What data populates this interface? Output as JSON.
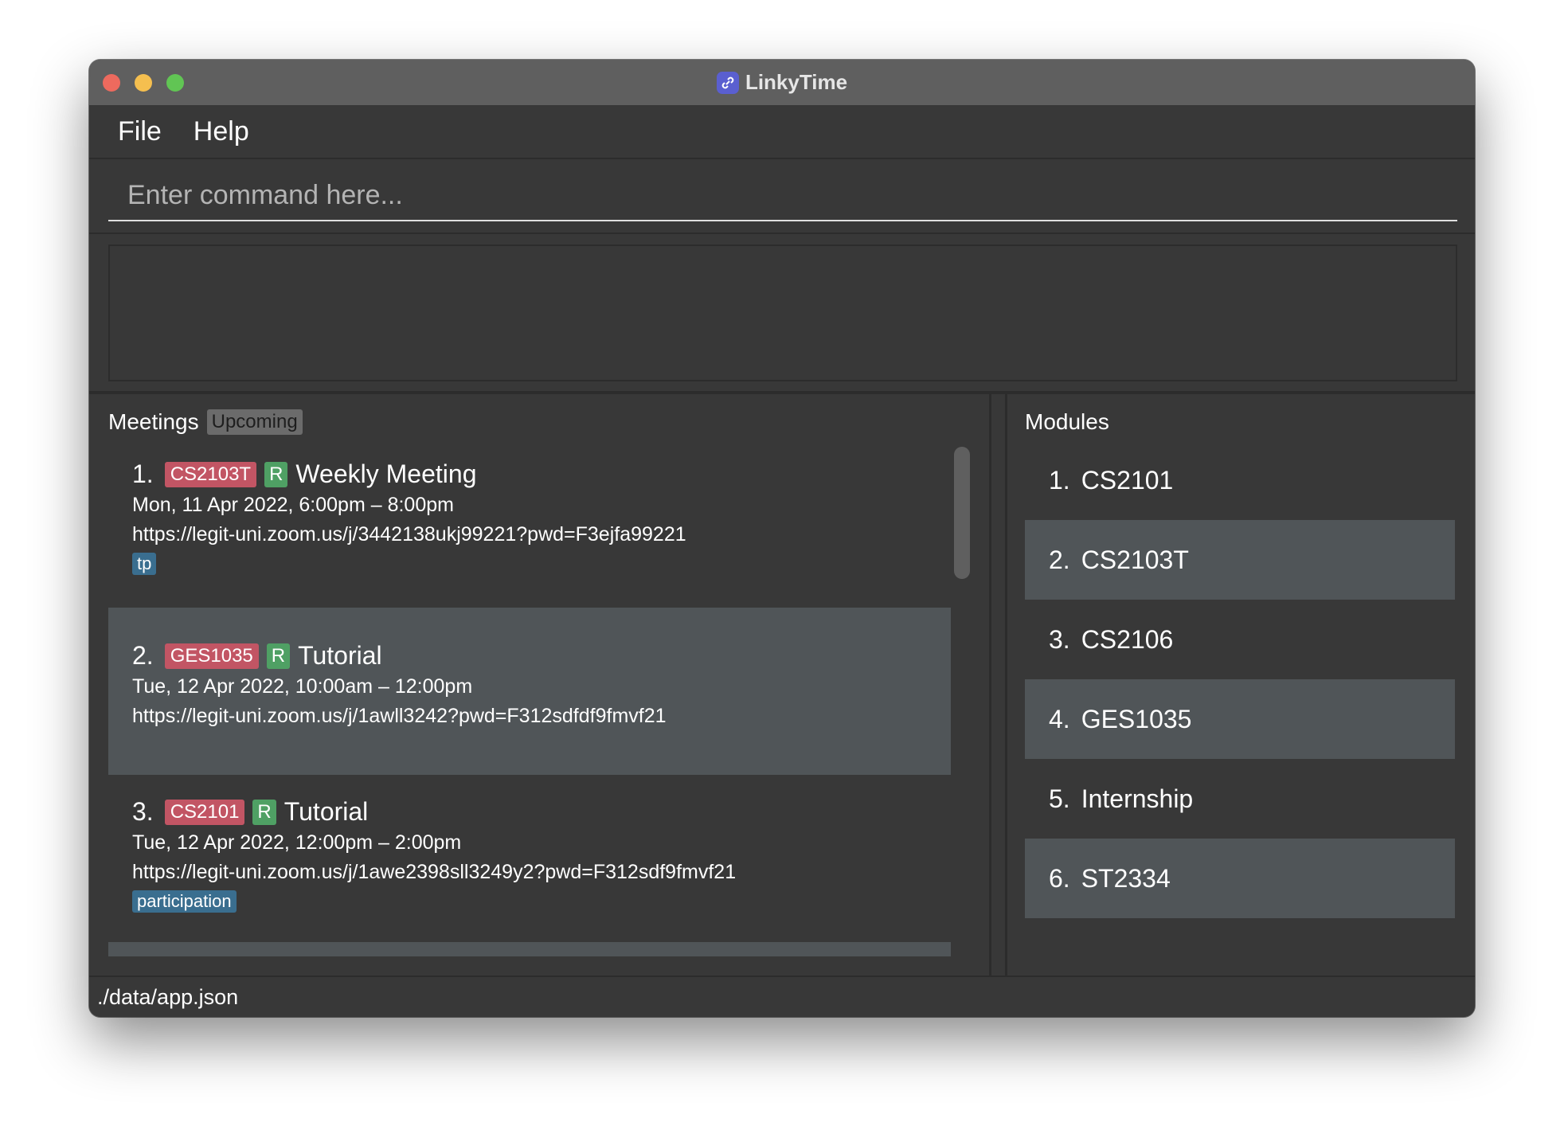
{
  "window": {
    "title": "LinkyTime"
  },
  "menu": {
    "file": "File",
    "help": "Help"
  },
  "command": {
    "placeholder": "Enter command here..."
  },
  "result": {
    "text": ""
  },
  "meetings": {
    "title": "Meetings",
    "filter_badge": "Upcoming",
    "items": [
      {
        "index": "1.",
        "module": "CS2103T",
        "recurring": "R",
        "name": "Weekly Meeting",
        "time": "Mon, 11 Apr 2022, 6:00pm  –  8:00pm",
        "link": "https://legit-uni.zoom.us/j/3442138ukj99221?pwd=F3ejfa99221",
        "tag": "tp"
      },
      {
        "index": "2.",
        "module": "GES1035",
        "recurring": "R",
        "name": "Tutorial",
        "time": "Tue, 12 Apr 2022, 10:00am  –  12:00pm",
        "link": "https://legit-uni.zoom.us/j/1awll3242?pwd=F312sdfdf9fmvf21",
        "tag": ""
      },
      {
        "index": "3.",
        "module": "CS2101",
        "recurring": "R",
        "name": "Tutorial",
        "time": "Tue, 12 Apr 2022, 12:00pm  –  2:00pm",
        "link": "https://legit-uni.zoom.us/j/1awe2398sll3249y2?pwd=F312sdf9fmvf21",
        "tag": "participation"
      }
    ]
  },
  "modules": {
    "title": "Modules",
    "items": [
      {
        "index": "1.",
        "name": "CS2101"
      },
      {
        "index": "2.",
        "name": "CS2103T"
      },
      {
        "index": "3.",
        "name": "CS2106"
      },
      {
        "index": "4.",
        "name": "GES1035"
      },
      {
        "index": "5.",
        "name": "Internship"
      },
      {
        "index": "6.",
        "name": "ST2334"
      }
    ]
  },
  "status": {
    "path": "./data/app.json"
  },
  "colors": {
    "module_badge": "#c25564",
    "recurring_badge": "#4fa064",
    "tag_badge": "#3a6e8f",
    "background": "#383838",
    "alt_row": "#505558"
  }
}
